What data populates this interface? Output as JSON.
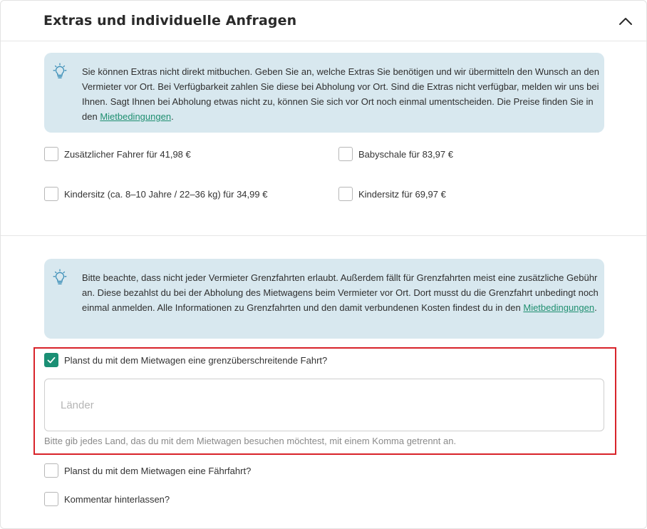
{
  "section": {
    "title": "Extras und individuelle Anfragen"
  },
  "extras_info": {
    "text": "Sie können Extras nicht direkt mitbuchen. Geben Sie an, welche Extras Sie benötigen und wir übermitteln den Wunsch an den Vermieter vor Ort. Bei Verfügbarkeit zahlen Sie diese bei Abholung vor Ort. Sind die Extras nicht verfügbar, melden wir uns bei Ihnen. Sagt Ihnen bei Abholung etwas nicht zu, können Sie sich vor Ort noch einmal umentscheiden. Die Preise finden Sie in den ",
    "link": "Mietbedingungen",
    "suffix": "."
  },
  "extras": [
    {
      "label": "Zusätzlicher Fahrer für 41,98 €",
      "checked": false
    },
    {
      "label": "Babyschale für 83,97 €",
      "checked": false
    },
    {
      "label": "Kindersitz (ca. 8–10 Jahre / 22–36 kg) für 34,99 €",
      "checked": false
    },
    {
      "label": "Kindersitz für 69,97 €",
      "checked": false
    }
  ],
  "border_info": {
    "text": "Bitte beachte, dass nicht jeder Vermieter Grenzfahrten erlaubt. Außerdem fällt für Grenzfahrten meist eine zusätzliche Gebühr an. Diese bezahlst du bei der Abholung des Mietwagens beim Vermieter vor Ort. Dort musst du die Grenzfahrt unbedingt noch einmal anmelden. Alle Informationen zu Grenzfahrten und den damit verbundenen Kosten findest du in den ",
    "link": "Mietbedingungen",
    "suffix": "."
  },
  "cross_border": {
    "label": "Planst du mit dem Mietwagen eine grenzüberschreitende Fahrt?",
    "checked": true,
    "countries_placeholder": "Länder",
    "countries_value": "",
    "hint": "Bitte gib jedes Land, das du mit dem Mietwagen besuchen möchtest, mit einem Komma getrennt an."
  },
  "ferry": {
    "label": "Planst du mit dem Mietwagen eine Fährfahrt?",
    "checked": false
  },
  "comment": {
    "label": "Kommentar hinterlassen?",
    "checked": false
  },
  "colors": {
    "accent": "#1a8f74",
    "info_bg": "#d8e8ef",
    "highlight_border": "#d8232a",
    "link": "#1f8f70"
  },
  "icons": {
    "collapse": "chevron-up-icon",
    "info": "lightbulb-icon",
    "check": "checkmark-icon"
  }
}
